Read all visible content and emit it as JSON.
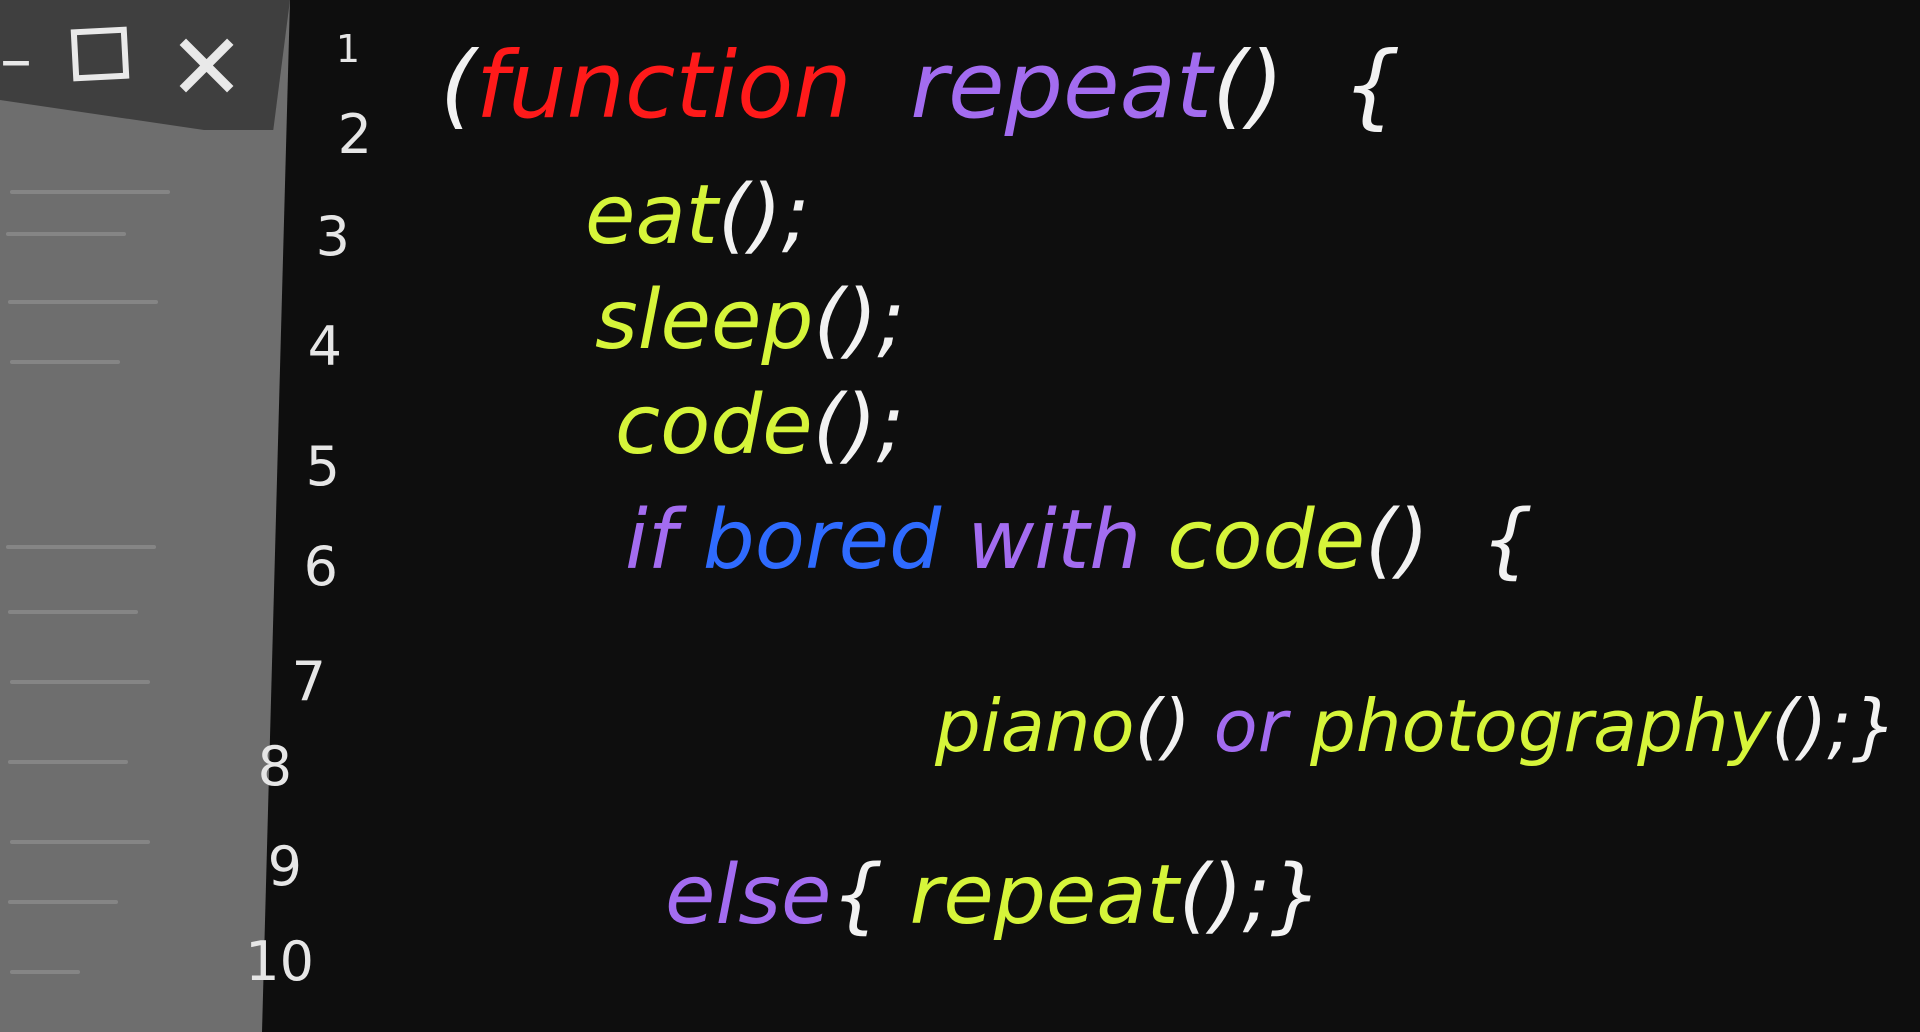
{
  "window": {
    "minimize_label": "–",
    "close_label": "✕",
    "icons": [
      "minimize-icon",
      "maximize-icon",
      "close-icon"
    ]
  },
  "colors": {
    "background": "#0e0e0e",
    "sidebar": "#6e6e6e",
    "keyword_red": "#ff1a1a",
    "keyword_purple": "#a36cf0",
    "identifier_lime": "#d6f53a",
    "keyword_blue": "#2f6bff",
    "punctuation": "#f2f2f2"
  },
  "line_numbers": [
    "1",
    "2",
    "3",
    "4",
    "5",
    "6",
    "7",
    "8",
    "9",
    "10"
  ],
  "code_lines": [
    {
      "tokens": [
        {
          "text": "(",
          "color": "#f2f2f2"
        },
        {
          "text": "function",
          "color": "#ff1a1a"
        },
        {
          "text": "  repeat",
          "color": "#a36cf0"
        },
        {
          "text": "()  {",
          "color": "#f2f2f2"
        }
      ]
    },
    {
      "tokens": [
        {
          "text": "eat",
          "color": "#d6f53a"
        },
        {
          "text": "();",
          "color": "#f2f2f2"
        }
      ]
    },
    {
      "tokens": [
        {
          "text": "sleep",
          "color": "#d6f53a"
        },
        {
          "text": "();",
          "color": "#f2f2f2"
        }
      ]
    },
    {
      "tokens": [
        {
          "text": "code",
          "color": "#d6f53a"
        },
        {
          "text": "();",
          "color": "#f2f2f2"
        }
      ]
    },
    {
      "tokens": [
        {
          "text": "if ",
          "color": "#a36cf0"
        },
        {
          "text": "bored ",
          "color": "#2f6bff"
        },
        {
          "text": "with ",
          "color": "#a36cf0"
        },
        {
          "text": "code",
          "color": "#d6f53a"
        },
        {
          "text": "()  {",
          "color": "#f2f2f2"
        }
      ]
    },
    {
      "tokens": [
        {
          "text": "piano",
          "color": "#d6f53a"
        },
        {
          "text": "() ",
          "color": "#f2f2f2"
        },
        {
          "text": "or ",
          "color": "#a36cf0"
        },
        {
          "text": "photography",
          "color": "#d6f53a"
        },
        {
          "text": "();}",
          "color": "#f2f2f2"
        }
      ]
    },
    {
      "tokens": [
        {
          "text": "else",
          "color": "#a36cf0"
        },
        {
          "text": "{ ",
          "color": "#f2f2f2"
        },
        {
          "text": "repeat",
          "color": "#d6f53a"
        },
        {
          "text": "();}",
          "color": "#f2f2f2"
        }
      ]
    }
  ]
}
